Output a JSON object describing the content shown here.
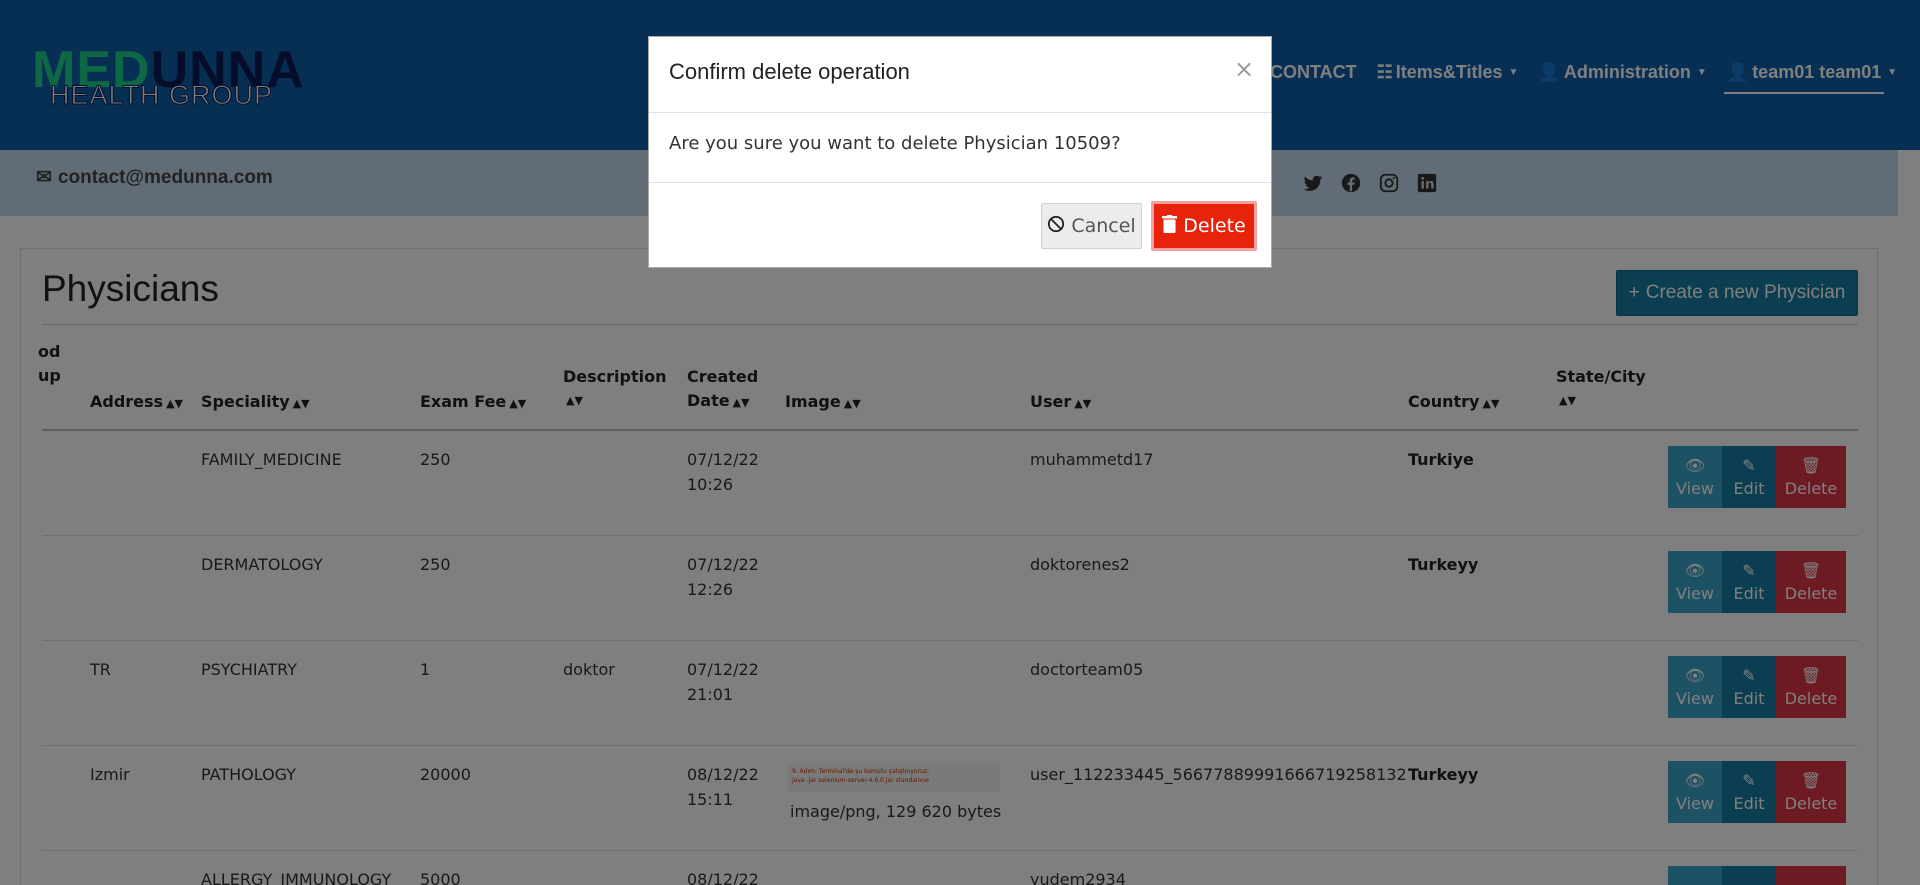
{
  "brand": {
    "logo_top": "MEDUNNA",
    "logo_top_a": "MED",
    "logo_top_b": "UNNA",
    "logo_bottom": "HEALTH GROUP"
  },
  "nav": {
    "contact": "CONTACT",
    "items_titles": "Items&Titles",
    "administration": "Administration",
    "account": "team01 team01"
  },
  "contact_bar": {
    "email": "contact@medunna.com"
  },
  "page": {
    "title": "Physicians",
    "create_button": "Create a new Physician"
  },
  "table": {
    "headers": {
      "blood_group_part1": "od",
      "blood_group_part2": "up",
      "address": "Address",
      "speciality": "Speciality",
      "exam_fee": "Exam Fee",
      "description": "Description",
      "created_date_1": "Created",
      "created_date_2": "Date",
      "image": "Image",
      "user": "User",
      "country": "Country",
      "state_city": "State/City"
    },
    "rows": [
      {
        "address": "",
        "speciality": "FAMILY_MEDICINE",
        "exam_fee": "250",
        "description": "",
        "date": "07/12/22",
        "time": "10:26",
        "image": "",
        "user": "muhammetd17",
        "country": "Turkiye"
      },
      {
        "address": "",
        "speciality": "DERMATOLOGY",
        "exam_fee": "250",
        "description": "",
        "date": "07/12/22",
        "time": "12:26",
        "image": "",
        "user": "doktorenes2",
        "country": "Turkeyy"
      },
      {
        "address": "TR",
        "speciality": "PSYCHIATRY",
        "exam_fee": "1",
        "description": "doktor",
        "date": "07/12/22",
        "time": "21:01",
        "image": "",
        "user": "doctorteam05",
        "country": ""
      },
      {
        "address": "Izmir",
        "speciality": "PATHOLOGY",
        "exam_fee": "20000",
        "description": "",
        "date": "08/12/22",
        "time": "15:11",
        "image": "image/png, 129 620 bytes",
        "user": "user_112233445_566778899916667192581​32",
        "country": "Turkeyy"
      },
      {
        "address": "",
        "speciality": "ALLERGY_IMMUNOLOGY",
        "exam_fee": "5000",
        "description": "",
        "date": "08/12/22",
        "time": "",
        "image": "",
        "user": "yudem2934",
        "country": ""
      }
    ],
    "thumbnail_text_1": "9. Adım: Terminal'de şu komutu çalıştırıyoruz:",
    "thumbnail_text_2": "java -jar selenium-server-4.6.0.jar standalone",
    "actions": {
      "view": "View",
      "edit": "Edit",
      "delete": "Delete"
    }
  },
  "modal": {
    "title": "Confirm delete operation",
    "close": "×",
    "message": "Are you sure you want to delete Physician 10509?",
    "cancel": "Cancel",
    "delete": "Delete"
  },
  "colors": {
    "header": "#0f5fa8",
    "accent": "#177da1",
    "danger": "#dc3545",
    "modal_delete": "#e8230c"
  }
}
